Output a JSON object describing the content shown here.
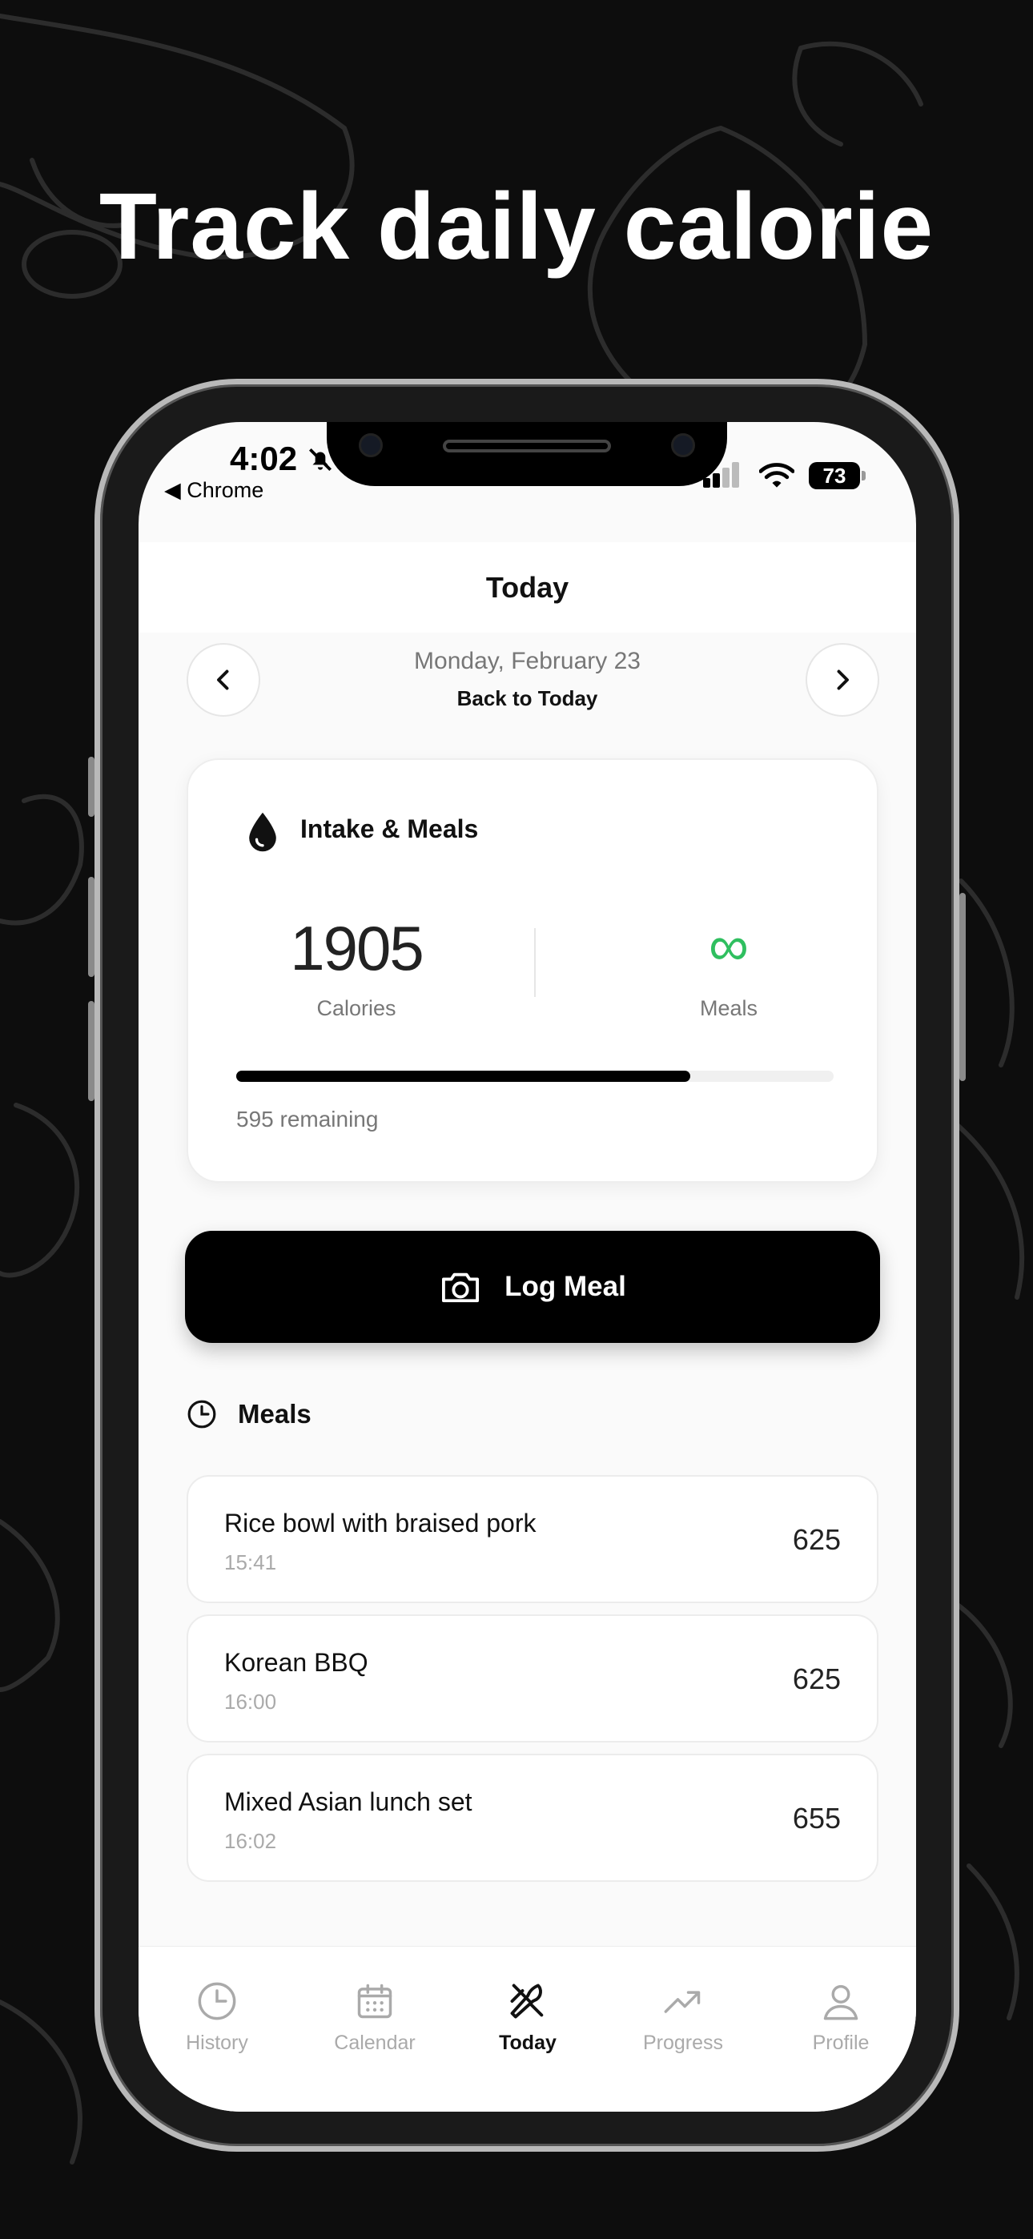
{
  "headline": "Track daily calorie",
  "status_bar": {
    "time": "4:02",
    "back_app": "◀ Chrome",
    "battery": "73"
  },
  "header": {
    "title": "Today"
  },
  "date_nav": {
    "date": "Monday, February 23",
    "back_label": "Back to Today"
  },
  "intake_card": {
    "title": "Intake & Meals",
    "calories_value": "1905",
    "calories_label": "Calories",
    "meals_value": "∞",
    "meals_label": "Meals",
    "progress_fraction": 0.76,
    "remaining": "595 remaining"
  },
  "log_button": {
    "label": "Log Meal"
  },
  "meals_section": {
    "title": "Meals",
    "items": [
      {
        "name": "Rice bowl with braised pork",
        "time": "15:41",
        "calories": "625"
      },
      {
        "name": "Korean BBQ",
        "time": "16:00",
        "calories": "625"
      },
      {
        "name": "Mixed Asian lunch set",
        "time": "16:02",
        "calories": "655"
      }
    ]
  },
  "tab_bar": {
    "tabs": [
      {
        "label": "History",
        "icon": "clock-icon",
        "active": false
      },
      {
        "label": "Calendar",
        "icon": "calendar-icon",
        "active": false
      },
      {
        "label": "Today",
        "icon": "fork-knife-icon",
        "active": true
      },
      {
        "label": "Progress",
        "icon": "trend-icon",
        "active": false
      },
      {
        "label": "Profile",
        "icon": "person-icon",
        "active": false
      }
    ]
  },
  "colors": {
    "background": "#0d0d0d",
    "accent_green": "#2fbf5f",
    "primary": "#000000",
    "muted": "#777777"
  }
}
